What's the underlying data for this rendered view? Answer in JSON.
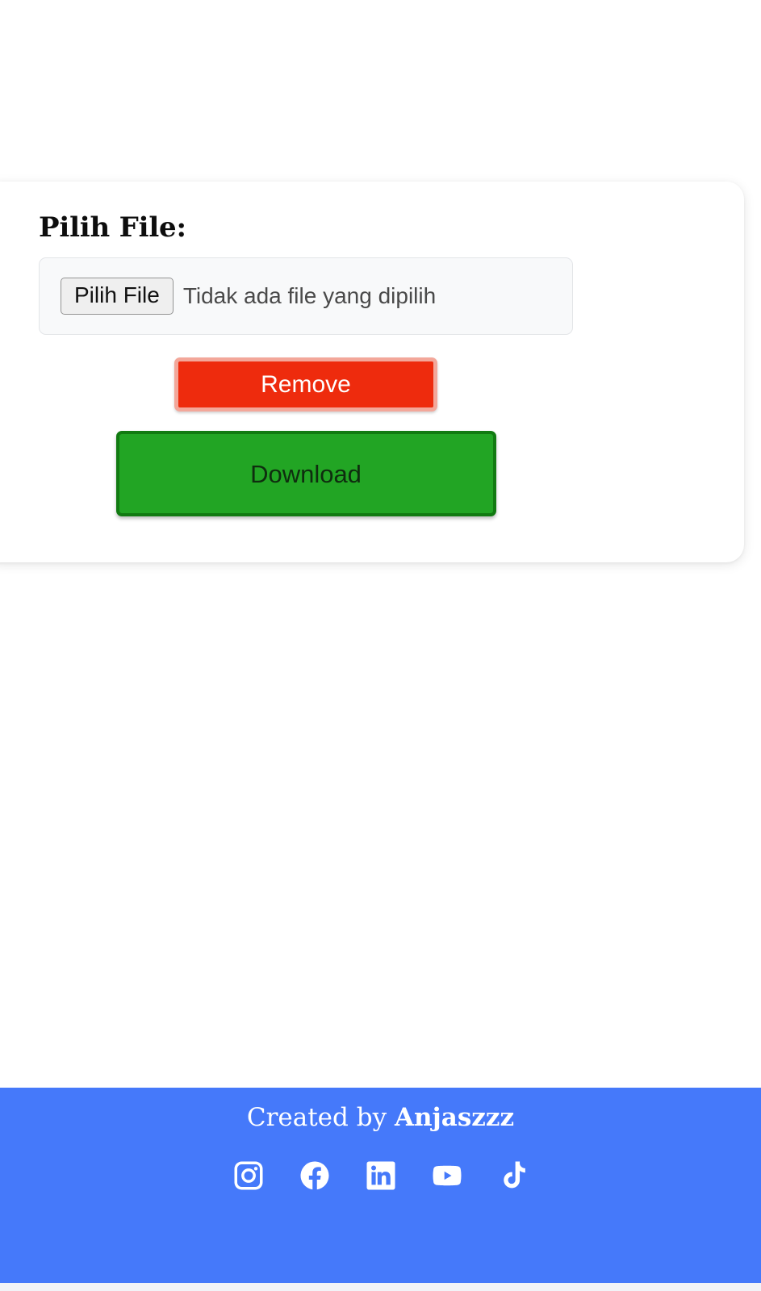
{
  "card": {
    "field_label": "Pilih File:",
    "file_input": {
      "browse_label": "Pilih File",
      "status_text": "Tidak ada file yang dipilih"
    },
    "buttons": {
      "remove_label": "Remove",
      "download_label": "Download"
    }
  },
  "footer": {
    "credit_prefix": "Created by ",
    "author": "Anjaszzz",
    "background_color": "#4579fa",
    "social": [
      {
        "name": "instagram",
        "label": "Instagram"
      },
      {
        "name": "facebook",
        "label": "Facebook"
      },
      {
        "name": "linkedin",
        "label": "LinkedIn"
      },
      {
        "name": "youtube",
        "label": "YouTube"
      },
      {
        "name": "tiktok",
        "label": "TikTok"
      }
    ]
  },
  "colors": {
    "remove_button": "#ee2b0d",
    "remove_button_border": "#f3a79a",
    "download_button": "#22a524",
    "download_button_border": "#117a11",
    "footer_blue": "#4579fa",
    "card_background": "#ffffff",
    "file_field_background": "#f8f9fa"
  }
}
